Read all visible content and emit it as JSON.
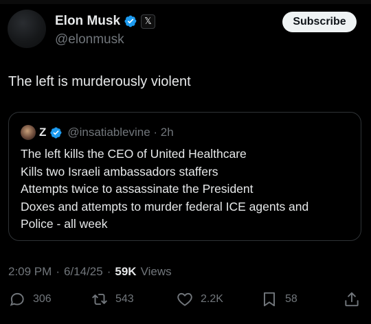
{
  "author": {
    "name": "Elon Musk",
    "handle": "@elonmusk",
    "verified_icon": "verified-badge-icon",
    "affiliation_icon": "x-logo-icon",
    "affiliation_glyph": "𝕏"
  },
  "actions_top": {
    "subscribe_label": "Subscribe"
  },
  "tweet": {
    "text": "The left is murderously violent"
  },
  "quoted": {
    "name": "Z",
    "handle_time": "@insatiablevine · 2h",
    "lines": [
      "The left kills the CEO of United Healthcare",
      "Kills two Israeli ambassadors staffers",
      "Attempts twice to assassinate the President",
      "Doxes and attempts to murder federal ICE agents and",
      "Police - all week"
    ]
  },
  "meta": {
    "time": "2:09 PM",
    "date": "6/14/25",
    "separator": "·",
    "views_count": "59K",
    "views_label": "Views"
  },
  "engagement": {
    "replies": "306",
    "reposts": "543",
    "likes": "2.2K",
    "bookmarks": "58"
  },
  "colors": {
    "background": "#000000",
    "text": "#e7e9ea",
    "secondary": "#71767b",
    "verified": "#1d9bf0",
    "border": "#2f3336"
  }
}
